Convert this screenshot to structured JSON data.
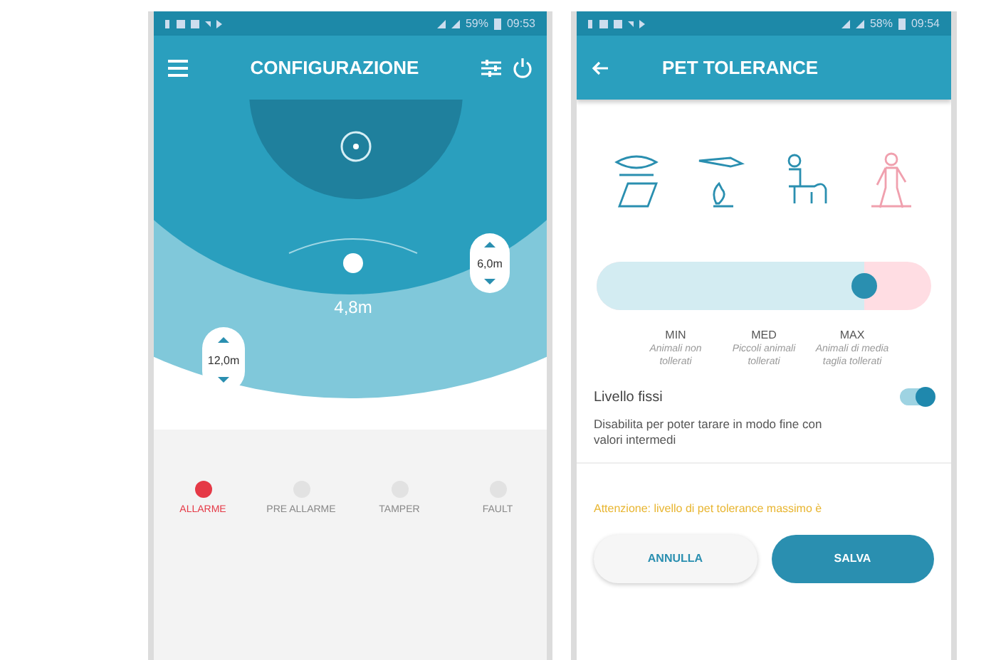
{
  "phones": [
    {
      "status_bar": {
        "battery": "59%",
        "time": "09:53"
      },
      "app_bar": {
        "title": "CONFIGURAZIONE"
      },
      "radar": {
        "center_label": "4,8m",
        "right_label": "6,0m",
        "left_label": "12,0m"
      },
      "bottom_nav": [
        {
          "label": "ALLARME",
          "on": true
        },
        {
          "label": "PRE ALLARME",
          "on": false
        },
        {
          "label": "TAMPER",
          "on": false
        },
        {
          "label": "FAULT",
          "on": false
        }
      ]
    },
    {
      "status_bar": {
        "battery": "58%",
        "time": "09:54"
      },
      "app_bar": {
        "title": "PET TOLERANCE"
      },
      "pets": [
        {
          "kind": "small",
          "selected": false
        },
        {
          "kind": "cat",
          "selected": false
        },
        {
          "kind": "dog",
          "selected": false
        },
        {
          "kind": "person",
          "selected": true
        }
      ],
      "slider": {
        "level": 0.8
      },
      "levels": [
        {
          "label": "MIN",
          "description": "Animali non tollerati"
        },
        {
          "label": "MED",
          "description": "Piccoli animali tollerati"
        },
        {
          "label": "MAX",
          "description": "Animali di media taglia tollerati"
        }
      ],
      "toggle": {
        "label": "Livello fissi",
        "on": true,
        "description": "Disabilita per poter tarare in modo fine con valori intermedi"
      },
      "warning": "Attenzione: livello di pet tolerance massimo è",
      "buttons": [
        {
          "label": "ANNULLA",
          "kind": "outline"
        },
        {
          "label": "SALVA",
          "kind": "filled"
        }
      ]
    }
  ]
}
